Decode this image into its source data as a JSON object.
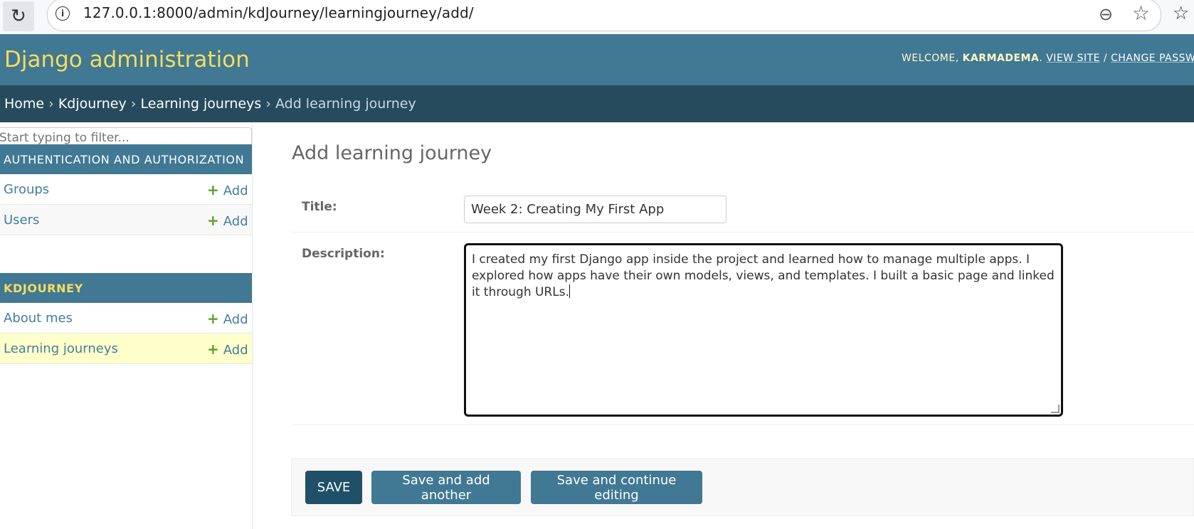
{
  "browser": {
    "url": "127.0.0.1:8000/admin/kdJourney/learningjourney/add/"
  },
  "header": {
    "brand": "Django administration",
    "welcome": "Welcome,",
    "username": "karmadema",
    "view_site": "View site",
    "change_password": "Change password"
  },
  "breadcrumbs": {
    "home": "Home",
    "app": "Kdjourney",
    "model": "Learning journeys",
    "current": "Add learning journey",
    "separator": "›"
  },
  "sidebar": {
    "filter_placeholder": "Start typing to filter...",
    "apps": [
      {
        "caption": "Authentication and Authorization",
        "models": [
          {
            "label": "Groups",
            "add_label": "Add"
          },
          {
            "label": "Users",
            "add_label": "Add"
          }
        ]
      },
      {
        "caption": "Kdjourney",
        "models": [
          {
            "label": "About mes",
            "add_label": "Add"
          },
          {
            "label": "Learning journeys",
            "add_label": "Add"
          }
        ]
      }
    ]
  },
  "form": {
    "title": "Add learning journey",
    "title_label": "Title:",
    "title_value": "Week 2: Creating My First App",
    "description_label": "Description:",
    "description_value": "I created my first Django app inside the project and learned how to manage multiple apps. I explored how apps have their own models, views, and templates. I built a basic page and linked it through URLs."
  },
  "buttons": {
    "save": "Save",
    "save_add_another": "Save and add another",
    "save_continue": "Save and continue editing"
  },
  "colors": {
    "header_bg": "#417893",
    "breadcrumbs_bg": "#264b5d",
    "brand_text": "#f5dd5d",
    "link": "#447e9b",
    "add_plus": "#5e9e2a",
    "current_row": "#ffffcc",
    "save_button": "#205067"
  }
}
